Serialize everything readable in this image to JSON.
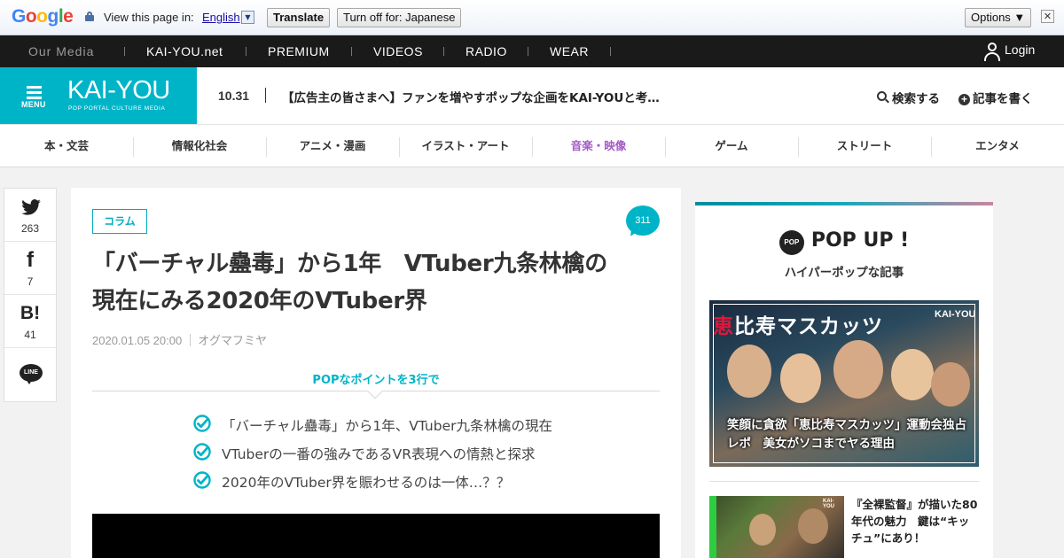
{
  "translate_bar": {
    "logo_letters": [
      "G",
      "o",
      "o",
      "g",
      "l",
      "e"
    ],
    "logo_colors": [
      "#4285f4",
      "#ea4335",
      "#fbbc05",
      "#4285f4",
      "#34a853",
      "#ea4335"
    ],
    "prompt": "View this page in:",
    "language": "English",
    "translate_label": "Translate",
    "turnoff_label": "Turn off for: Japanese",
    "options_label": "Options ▼",
    "close_glyph": "✕"
  },
  "media_nav": {
    "our_media": "Our Media",
    "items": [
      "KAI-YOU.net",
      "PREMIUM",
      "VIDEOS",
      "RADIO",
      "WEAR"
    ],
    "login_label": "Login"
  },
  "header": {
    "menu_label": "MENU",
    "logo_text": "KAI-YOU",
    "logo_sub": "POP PORTAL CULTURE MEDIA",
    "news_date": "10.31",
    "news_text": "【広告主の皆さまへ】ファンを増やすポップな企画をKAI-YOUと考…",
    "search_label": "検索する",
    "write_label": "記事を書く",
    "brand_color": "#00b4c8"
  },
  "categories": {
    "items": [
      "本・文芸",
      "情報化社会",
      "アニメ・漫画",
      "イラスト・アート",
      "音楽・映像",
      "ゲーム",
      "ストリート",
      "エンタメ"
    ],
    "active_index": 4,
    "active_color": "#a35bc4"
  },
  "share": {
    "twitter_count": "263",
    "facebook_glyph": "f",
    "facebook_count": "7",
    "hatena_glyph": "B!",
    "hatena_count": "41",
    "line_label": "LINE"
  },
  "article": {
    "tag": "コラム",
    "comment_count": "311",
    "title_line1": "「バーチャル蠱毒」から1年　VTuber九条林檎の",
    "title_line2": "現在にみる2020年のVTuber界",
    "date": "2020.01.05 20:00",
    "author": "オグマフミヤ",
    "pop_heading": "POPなポイントを3行で",
    "points": [
      "「バーチャル蠱毒」から1年、VTuber九条林檎の現在",
      "VTuberの一番の強みであるVR表現への情熱と探求",
      "2020年のVTuber界を賑わせるのは一体…？？"
    ]
  },
  "sidebar": {
    "pop_badge": "POP",
    "title": "POP UP !",
    "subtitle": "ハイパーポップな記事",
    "feature_banner_red": "恵",
    "feature_banner_white": "比寿マスカッツ",
    "feature_logo": "KAI-YOU",
    "feature_caption": "笑顔に貪欲「恵比寿マスカッツ」運動会独占レポ　美女がソコまでヤる理由",
    "thumb_logo": "KAI-YOU",
    "article2_title": "『全裸監督』が描いた80年代の魅力　鍵は“キッチュ”にあり！"
  }
}
